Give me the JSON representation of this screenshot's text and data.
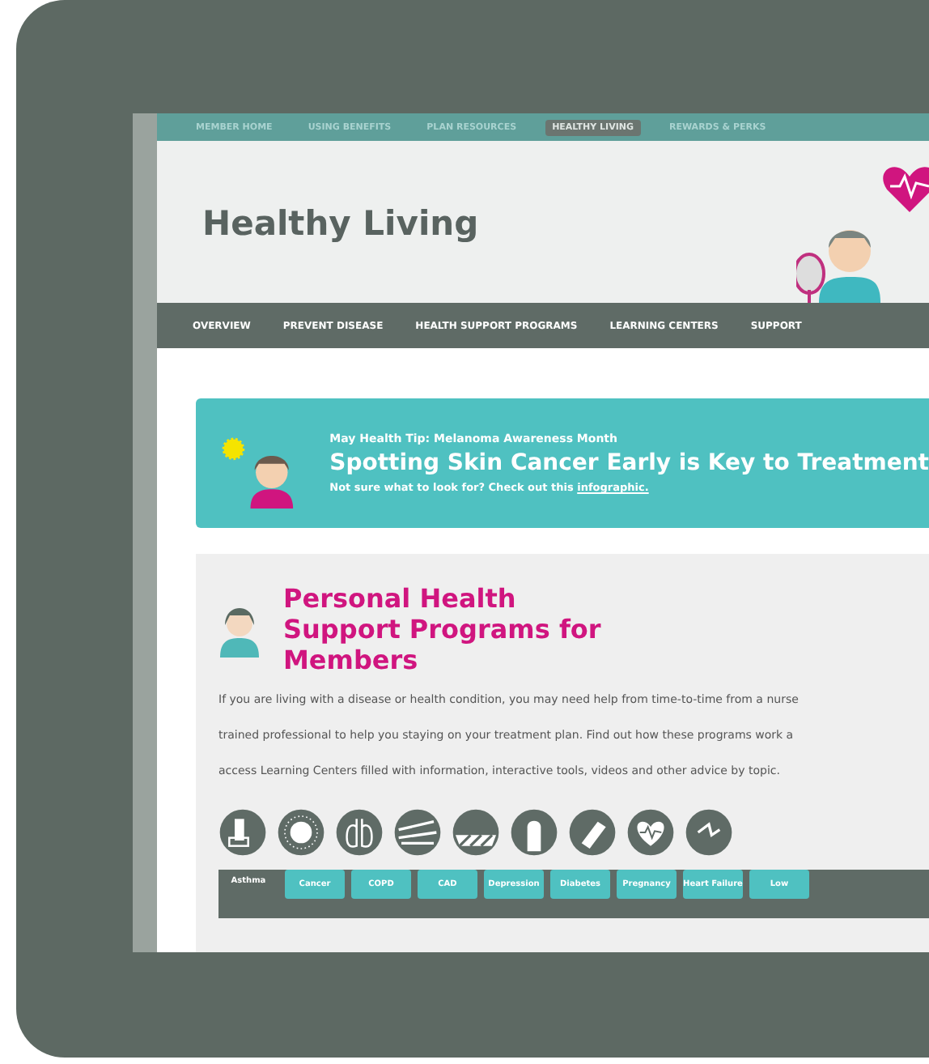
{
  "top_nav": [
    {
      "label": "MEMBER HOME",
      "selected": false
    },
    {
      "label": "USING BENEFITS",
      "selected": false
    },
    {
      "label": "PLAN RESOURCES",
      "selected": false
    },
    {
      "label": "HEALTHY LIVING",
      "selected": true
    },
    {
      "label": "REWARDS & PERKS",
      "selected": false
    }
  ],
  "header": {
    "title": "Healthy Living"
  },
  "sub_nav": [
    "OVERVIEW",
    "PREVENT DISEASE",
    "HEALTH SUPPORT PROGRAMS",
    "LEARNING CENTERS",
    "SUPPORT"
  ],
  "banner": {
    "kicker": "May Health Tip: Melanoma Awareness Month",
    "headline": "Spotting Skin Cancer Early is Key to Treatment",
    "text": "Not sure what to look for? Check out this",
    "link": "infographic."
  },
  "programs": {
    "title": "Personal Health Support Programs for Members",
    "lines": [
      "If you are living with a disease or health condition, you may need help from time-to-time from a nurse",
      "trained professional to help you staying on your treatment plan. Find out how these programs work a",
      "access Learning Centers filled with information, interactive tools, videos and other advice by topic."
    ],
    "tabs": [
      {
        "label": "Asthma",
        "selected": true
      },
      {
        "label": "Cancer",
        "selected": false
      },
      {
        "label": "COPD",
        "selected": false
      },
      {
        "label": "CAD",
        "selected": false
      },
      {
        "label": "Depression",
        "selected": false
      },
      {
        "label": "Diabetes",
        "selected": false
      },
      {
        "label": "Pregnancy",
        "selected": false
      },
      {
        "label": "Heart Failure",
        "selected": false
      },
      {
        "label": "Low",
        "selected": false
      }
    ]
  }
}
